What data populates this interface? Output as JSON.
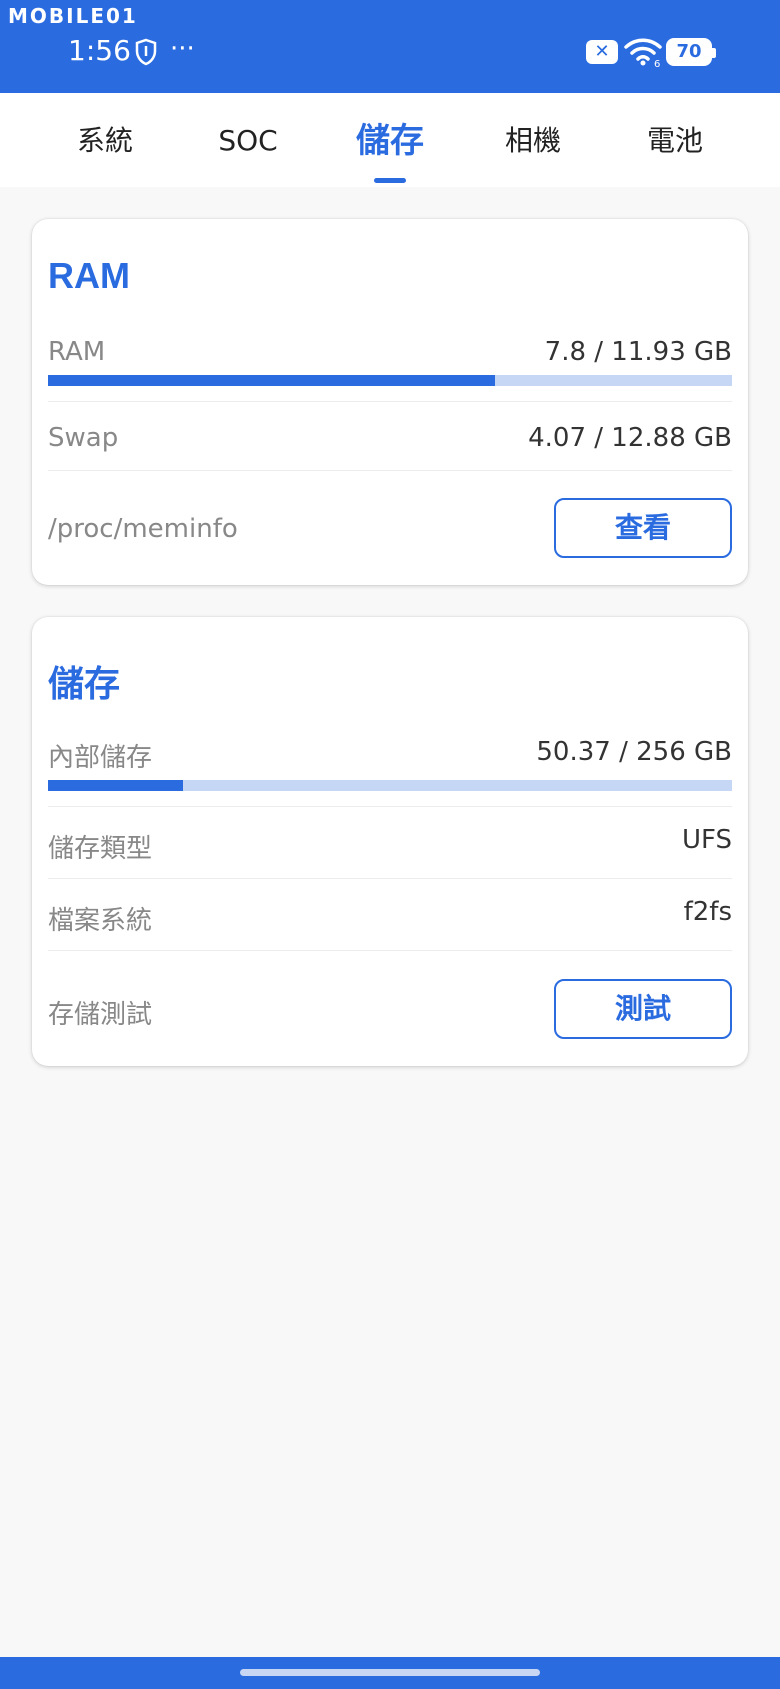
{
  "status_bar": {
    "watermark": "MOBILE01",
    "time": "1:56",
    "overflow": "···",
    "sim_icon": "x-icon",
    "wifi_badge": "6",
    "battery": "70",
    "color": "#2a6be0"
  },
  "tabs": [
    {
      "label": "系統",
      "active": false
    },
    {
      "label": "SOC",
      "active": false
    },
    {
      "label": "儲存",
      "active": true
    },
    {
      "label": "相機",
      "active": false
    },
    {
      "label": "電池",
      "active": false
    }
  ],
  "ram_card": {
    "title": "RAM",
    "ram": {
      "label": "RAM",
      "value": "7.8 / 11.93 GB",
      "used_fraction": 0.654
    },
    "swap": {
      "label": "Swap",
      "value": "4.07 / 12.88 GB"
    },
    "meminfo": {
      "label": "/proc/meminfo",
      "button": "查看"
    }
  },
  "storage_card": {
    "title": "儲存",
    "internal": {
      "label": "內部儲存",
      "value": "50.37 / 256 GB",
      "used_fraction": 0.197
    },
    "type": {
      "label": "儲存類型",
      "value": "UFS"
    },
    "filesystem": {
      "label": "檔案系統",
      "value": "f2fs"
    },
    "test": {
      "label": "存儲測試",
      "button": "測試"
    }
  }
}
